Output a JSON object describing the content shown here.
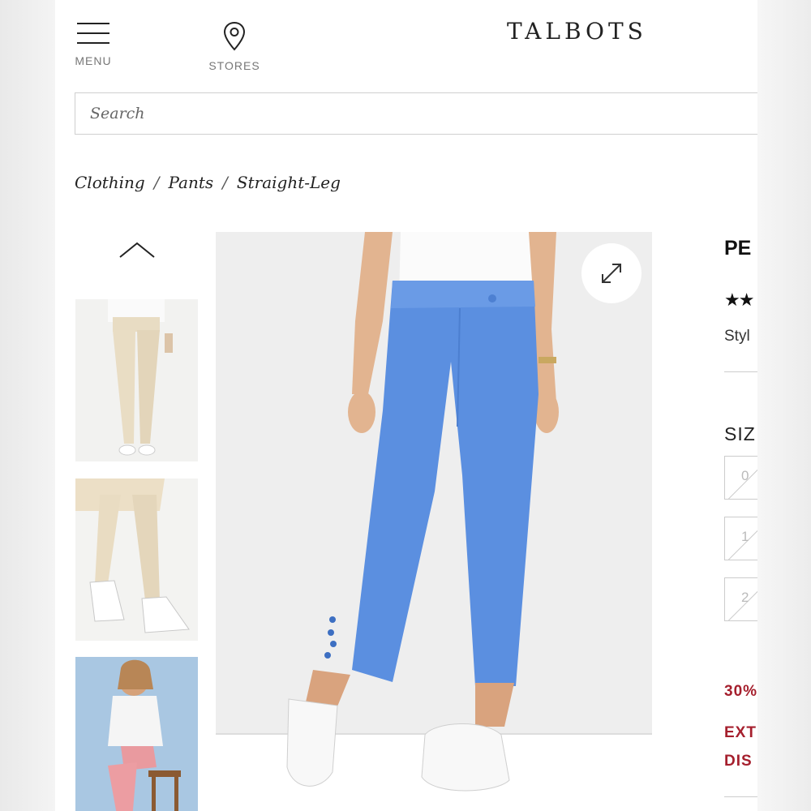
{
  "header": {
    "menu_label": "MENU",
    "stores_label": "STORES",
    "logo": "TALBOTS"
  },
  "search": {
    "placeholder": "Search"
  },
  "breadcrumb": {
    "items": [
      "Clothing",
      "Pants",
      "Straight-Leg"
    ],
    "separator": "/"
  },
  "product": {
    "title_visible": "PE",
    "stars_visible": "★★",
    "style_visible": "Styl",
    "size_label_visible": "SIZ",
    "sizes_visible": [
      "0",
      "1",
      "2"
    ],
    "promo_1_visible": "30%",
    "promo_2_line1_visible": "EXT",
    "promo_2_line2_visible": "DIS"
  },
  "colors": {
    "accent_red": "#a51f2d",
    "pants_blue": "#5b8fe0",
    "text_dark": "#222222"
  },
  "icons": [
    "hamburger-icon",
    "location-pin-icon",
    "chevron-up-icon",
    "expand-icon"
  ]
}
